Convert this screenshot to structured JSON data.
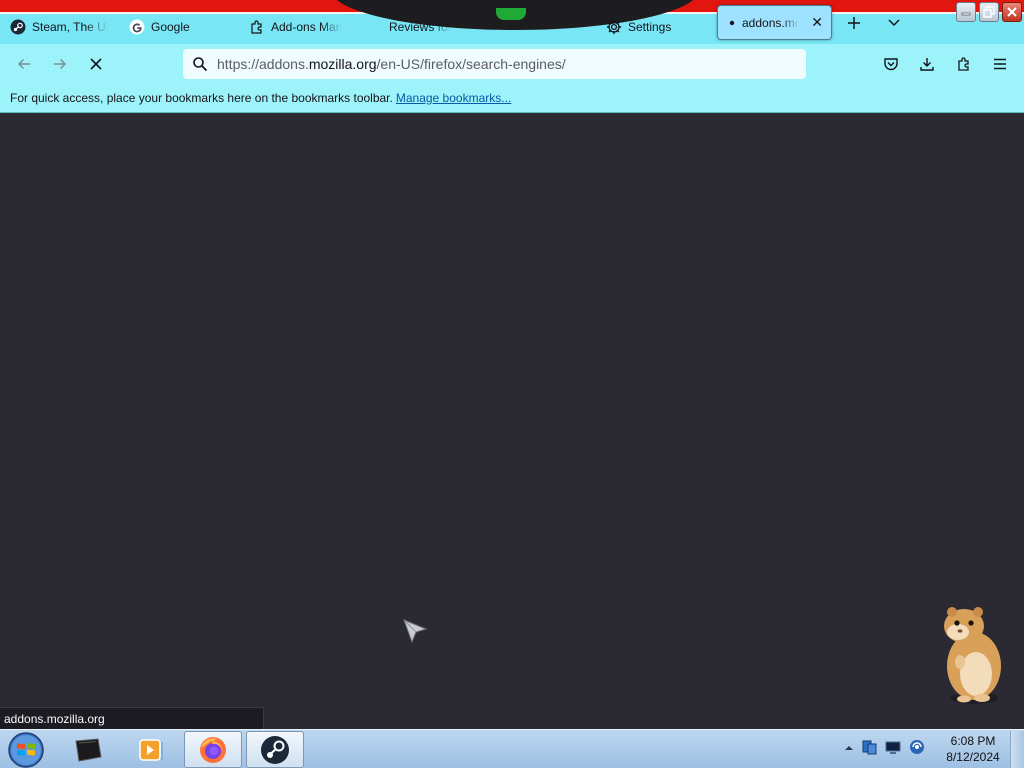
{
  "tabs": [
    {
      "label": "Steam, The Ul",
      "icon": "steam-icon",
      "active": false
    },
    {
      "label": "Google",
      "icon": "google-icon",
      "active": false
    },
    {
      "label": "Add-ons Man",
      "icon": "puzzle-icon",
      "active": false
    },
    {
      "label": "Reviews for",
      "icon": "none",
      "active": false
    },
    {
      "label": "Settings",
      "icon": "gear-icon",
      "active": false
    },
    {
      "label": "addons.mozi",
      "icon": "loading-dot-icon",
      "active": true
    }
  ],
  "navbar": {
    "url_domain_prefix": "https://addons.",
    "url_domain": "mozilla.org",
    "url_path": "/en-US/firefox/search-engines/"
  },
  "bookmarks": {
    "message": "For quick access, place your bookmarks here on the bookmarks toolbar.",
    "manage_link": "Manage bookmarks..."
  },
  "status": {
    "link_preview": "addons.mozilla.org"
  },
  "taskbar": {
    "pinned": [
      "windows-start-icon",
      "terminal-icon",
      "media-player-icon",
      "firefox-icon",
      "steam-icon"
    ],
    "tray_icons": [
      "show-hidden-icons",
      "network-icon",
      "monitor-icon",
      "language-icon"
    ],
    "time": "6:08 PM",
    "date": "8/12/2024"
  },
  "colors": {
    "toolbar_bg": "#9cf3f9",
    "tabstrip_bg": "#79e6f6",
    "content_bg": "#2b2a33",
    "title_accent": "#e3150f",
    "link": "#0a58a8"
  }
}
